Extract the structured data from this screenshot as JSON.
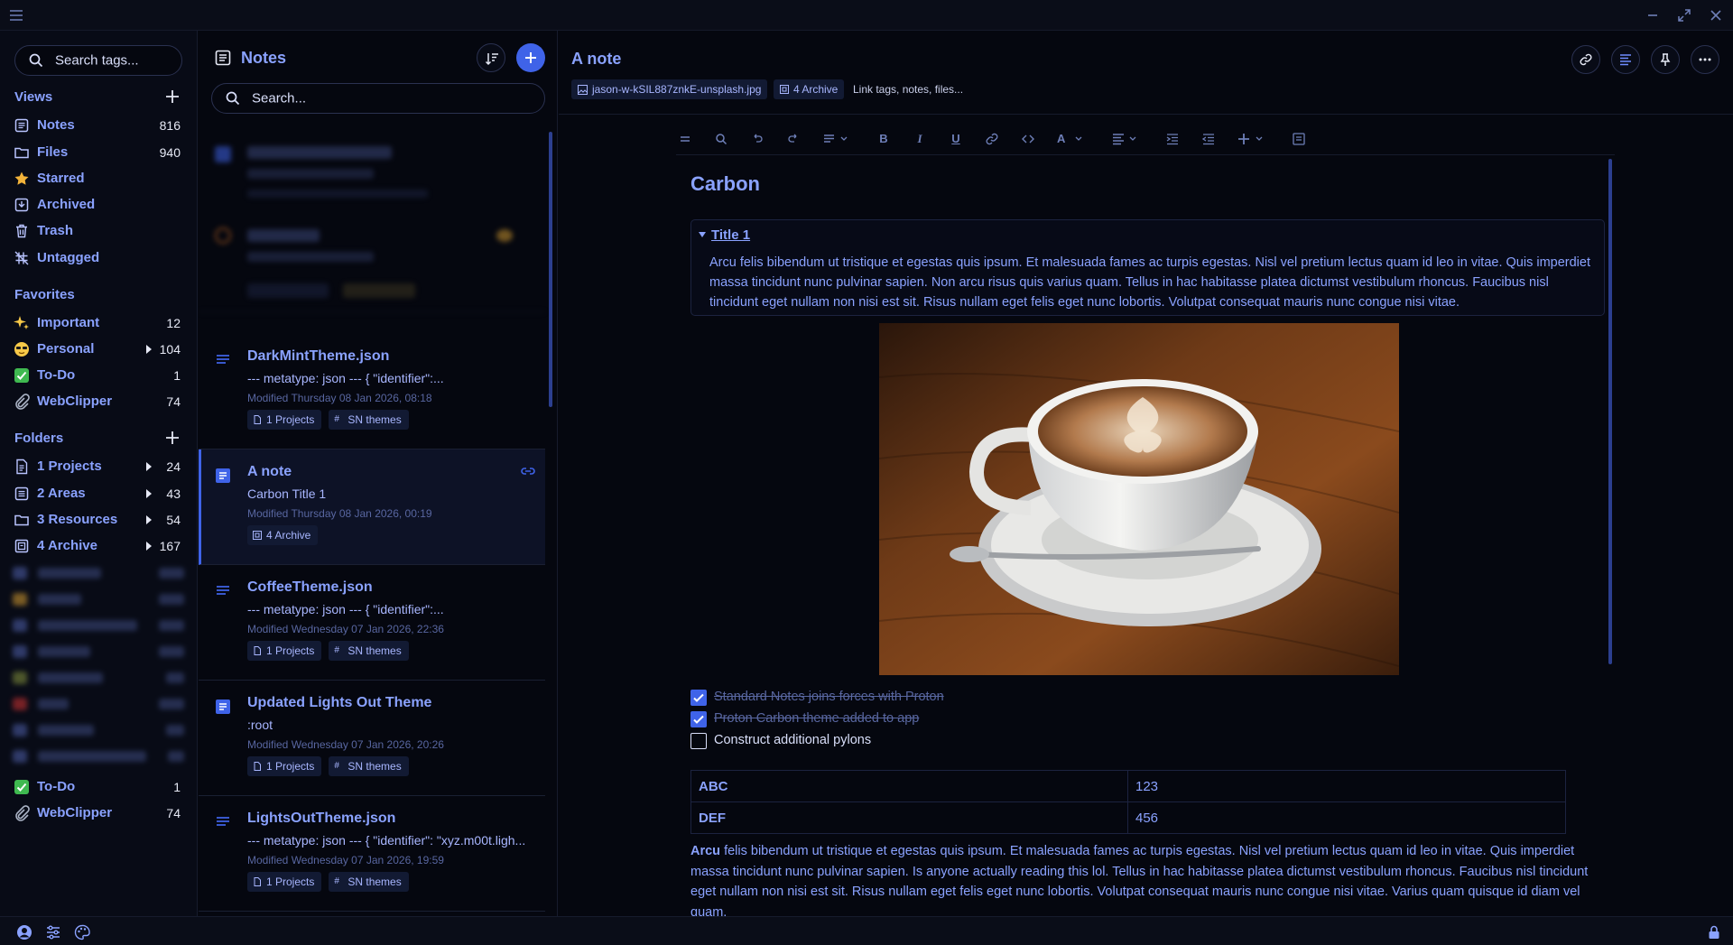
{
  "colors": {
    "accent": "#8aa2ff",
    "background": "#05070f",
    "panel": "#080b16",
    "selected": "#0d1226",
    "blue_button": "#3f63e8"
  },
  "sidebar": {
    "search_placeholder": "Search tags...",
    "views_heading": "Views",
    "views": [
      {
        "label": "Notes",
        "count": "816",
        "icon": "notes-icon"
      },
      {
        "label": "Files",
        "count": "940",
        "icon": "folder-icon"
      },
      {
        "label": "Starred",
        "count": "",
        "icon": "star-icon"
      },
      {
        "label": "Archived",
        "count": "",
        "icon": "archive-icon"
      },
      {
        "label": "Trash",
        "count": "",
        "icon": "trash-icon"
      },
      {
        "label": "Untagged",
        "count": "",
        "icon": "untagged-icon"
      }
    ],
    "favorites_heading": "Favorites",
    "favorites": [
      {
        "label": "Important",
        "count": "12",
        "icon": "sparkles-emoji"
      },
      {
        "label": "Personal",
        "count": "104",
        "icon": "sunglasses-emoji"
      },
      {
        "label": "To-Do",
        "count": "1",
        "icon": "check-mark-emoji"
      },
      {
        "label": "WebClipper",
        "count": "74",
        "icon": "paperclip-emoji"
      }
    ],
    "folders_heading": "Folders",
    "folders": [
      {
        "label": "1 Projects",
        "count": "24",
        "icon": "document-icon"
      },
      {
        "label": "2 Areas",
        "count": "43",
        "icon": "list-icon"
      },
      {
        "label": "3 Resources",
        "count": "54",
        "icon": "folder-icon"
      },
      {
        "label": "4 Archive",
        "count": "167",
        "icon": "archive-box-icon"
      }
    ],
    "bottom_items": [
      {
        "label": "To-Do",
        "count": "1",
        "icon": "check-mark-emoji"
      },
      {
        "label": "WebClipper",
        "count": "74",
        "icon": "paperclip-emoji"
      }
    ]
  },
  "notes_list": {
    "title": "Notes",
    "search_placeholder": "Search...",
    "notes": [
      {
        "title": "DarkMintTheme.json",
        "preview": "--- metatype: json --- { \"identifier\":...",
        "modified": "Modified Thursday 08 Jan 2026, 08:18",
        "tags": [
          "1 Projects",
          "SN themes"
        ],
        "icon": "plain-text-icon"
      },
      {
        "title": "A note",
        "preview": "Carbon Title 1",
        "modified": "Modified Thursday 08 Jan 2026, 00:19",
        "tags": [
          "4 Archive"
        ],
        "icon": "super-note-icon"
      },
      {
        "title": "CoffeeTheme.json",
        "preview": "--- metatype: json --- { \"identifier\":...",
        "modified": "Modified Wednesday 07 Jan 2026, 22:36",
        "tags": [
          "1 Projects",
          "SN themes"
        ],
        "icon": "plain-text-icon"
      },
      {
        "title": "Updated Lights Out Theme",
        "preview": ":root",
        "modified": "Modified Wednesday 07 Jan 2026, 20:26",
        "tags": [
          "1 Projects",
          "SN themes"
        ],
        "icon": "super-note-icon"
      },
      {
        "title": "LightsOutTheme.json",
        "preview": "--- metatype: json --- { \"identifier\": \"xyz.m00t.ligh...",
        "modified": "Modified Wednesday 07 Jan 2026, 19:59",
        "tags": [
          "1 Projects",
          "SN themes"
        ],
        "icon": "plain-text-icon"
      }
    ]
  },
  "editor": {
    "title": "A note",
    "chips": {
      "file": "jason-w-kSIL887znkE-unsplash.jpg",
      "tag": "4 Archive",
      "link_placeholder": "Link tags, notes, files..."
    },
    "heading": "Carbon",
    "collapsible_title": "Title 1",
    "collapsible_body": "Arcu felis bibendum ut tristique et egestas quis ipsum. Et malesuada fames ac turpis egestas. Nisl vel pretium lectus quam id leo in vitae. Quis imperdiet massa tincidunt nunc pulvinar sapien. Non arcu risus quis varius quam. Tellus in hac habitasse platea dictumst vestibulum rhoncus. Faucibus nisl tincidunt eget nullam non nisi est sit. Risus nullam eget felis eget nunc lobortis. Volutpat consequat mauris nunc congue nisi vitae.",
    "checklist": [
      {
        "text": "Standard Notes joins forces with Proton",
        "checked": true
      },
      {
        "text": "Proton Carbon theme added to app",
        "checked": true
      },
      {
        "text": "Construct additional pylons",
        "checked": false
      }
    ],
    "table": [
      [
        "ABC",
        "123"
      ],
      [
        "DEF",
        "456"
      ]
    ],
    "paragraph_bold": "Arcu",
    "paragraph": " felis bibendum ut tristique et egestas quis ipsum. Et malesuada fames ac turpis egestas. Nisl vel pretium lectus quam id leo in vitae. Quis imperdiet massa tincidunt nunc pulvinar sapien. Is anyone actually reading this lol. Tellus in hac habitasse platea dictumst vestibulum rhoncus. Faucibus nisl tincidunt eget nullam non nisi est sit. Risus nullam eget felis eget nunc lobortis. Volutpat consequat mauris nunc congue nisi vitae. Varius quam quisque id diam vel quam."
  }
}
